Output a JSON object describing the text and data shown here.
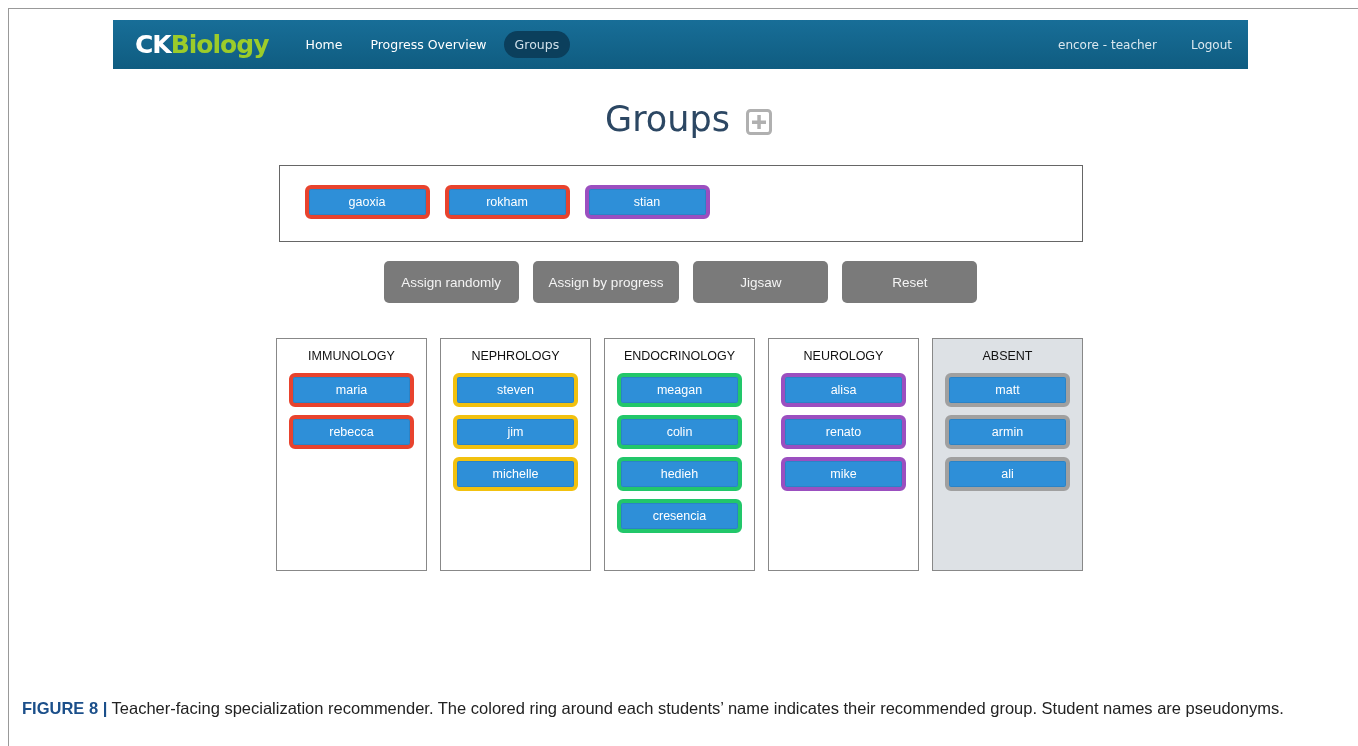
{
  "navbar": {
    "logo": {
      "part_1": "CK",
      "part_2": "Biology"
    },
    "items": [
      {
        "label": "Home",
        "selected": false
      },
      {
        "label": "Progress Overview",
        "selected": false
      },
      {
        "label": "Groups",
        "selected": true
      }
    ],
    "user": "encore - teacher",
    "logout": "Logout"
  },
  "page_title": "Groups",
  "unassigned": [
    {
      "name": "gaoxia",
      "color": "#e8432e"
    },
    {
      "name": "rokham",
      "color": "#e8432e"
    },
    {
      "name": "stian",
      "color": "#9b4fc0"
    }
  ],
  "buttons": [
    "Assign randomly",
    "Assign by progress",
    "Jigsaw",
    "Reset"
  ],
  "groups": [
    {
      "title": "IMMUNOLOGY",
      "kind": "topic",
      "students": [
        {
          "name": "maria",
          "color": "#e8432e"
        },
        {
          "name": "rebecca",
          "color": "#e8432e"
        }
      ]
    },
    {
      "title": "NEPHROLOGY",
      "kind": "topic",
      "students": [
        {
          "name": "steven",
          "color": "#f2c10f"
        },
        {
          "name": "jim",
          "color": "#f2c10f"
        },
        {
          "name": "michelle",
          "color": "#f2c10f"
        }
      ]
    },
    {
      "title": "ENDOCRINOLOGY",
      "kind": "topic",
      "students": [
        {
          "name": "meagan",
          "color": "#22c76a"
        },
        {
          "name": "colin",
          "color": "#22c76a"
        },
        {
          "name": "hedieh",
          "color": "#22c76a"
        },
        {
          "name": "cresencia",
          "color": "#22c76a"
        }
      ]
    },
    {
      "title": "NEUROLOGY",
      "kind": "topic",
      "students": [
        {
          "name": "alisa",
          "color": "#9b4fc0"
        },
        {
          "name": "renato",
          "color": "#9b4fc0"
        },
        {
          "name": "mike",
          "color": "#9b4fc0"
        }
      ]
    },
    {
      "title": "ABSENT",
      "kind": "absent",
      "students": [
        {
          "name": "matt",
          "color": "#a0a0a0"
        },
        {
          "name": "armin",
          "color": "#a0a0a0"
        },
        {
          "name": "ali",
          "color": "#a0a0a0"
        }
      ]
    }
  ],
  "caption": "**FIGURE 8 |** Teacher-facing specialization recommender. The colored ring around each students’ name indicates their recommended group. Student names are pseudonyms."
}
